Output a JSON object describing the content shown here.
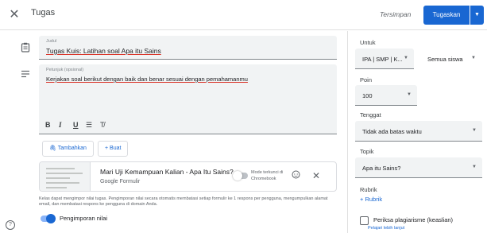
{
  "header": {
    "close_icon": "close-icon",
    "title": "Tugas",
    "saved_status": "Tersimpan",
    "assign_label": "Tugaskan",
    "assign_drop_icon": "caret-down-icon",
    "accent": "#1967d2"
  },
  "form": {
    "title_label": "Judul",
    "title_value": "Tugas Kuis: Latihan soal Apa itu Sains",
    "desc_label": "Petunjuk (opsional)",
    "desc_value": "Kerjakan soal berikut dengan baik dan benar sesuai dengan pemahamanmu",
    "format": {
      "bold": "B",
      "italic": "I",
      "underline": "U",
      "list": "☰",
      "clear": "T̸"
    },
    "add_button": "Tambahkan",
    "create_button": "Buat"
  },
  "attachment": {
    "title": "Mari Uji Kemampuan Kalian - Apa Itu Sains?",
    "subtitle": "Google Formulir",
    "lock_mode_label": "Mode terkunci di Chromebook"
  },
  "note": "Kelas dapat mengimpor nilai tugas. Pengimporan nilai secara otomatis membatasi setiap formulir ke 1 respons per pengguna, mengumpulkan alamat email, dan membatasi respons ke pengguna di domain Anda.",
  "grade_import_label": "Pengimporan nilai",
  "grade_import_on": true,
  "help_icon": "?",
  "side": {
    "for_label": "Untuk",
    "class_value": "IPA | SMP | K...",
    "students_value": "Semua siswa",
    "points_label": "Poin",
    "points_value": "100",
    "due_label": "Tenggat",
    "due_value": "Tidak ada batas waktu",
    "topic_label": "Topik",
    "topic_value": "Apa itu Sains?",
    "rubric_label": "Rubrik",
    "rubric_button": "Rubrik",
    "plagiarism_label": "Periksa plagiarisme (keaslian)",
    "learn_more": "Pelajari lebih lanjut"
  }
}
